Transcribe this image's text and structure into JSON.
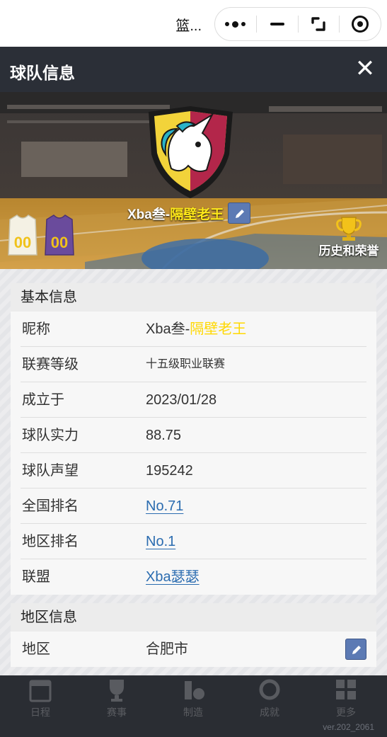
{
  "capsule": {
    "app_title": "篮...",
    "more_icon": "more-dots-icon",
    "minimize_icon": "minimize-icon",
    "switch_icon": "switch-icon",
    "close_icon": "record-circle-icon"
  },
  "dialog": {
    "title": "球队信息",
    "close_label": "✕"
  },
  "hero": {
    "team_prefix": "Xba叁-",
    "team_highlight": "隔壁老王",
    "jersey_numbers": [
      "00",
      "00"
    ],
    "honor_label": "历史和荣誉"
  },
  "basic_info": {
    "header": "基本信息",
    "rows": [
      {
        "label": "昵称",
        "value_prefix": "Xba叁-",
        "value_highlight": "隔壁老王"
      },
      {
        "label": "联赛等级",
        "value": "十五级职业联赛"
      },
      {
        "label": "成立于",
        "value": "2023/01/28"
      },
      {
        "label": "球队实力",
        "value": "88.75"
      },
      {
        "label": "球队声望",
        "value": "195242"
      },
      {
        "label": "全国排名",
        "value": "No.71"
      },
      {
        "label": "地区排名",
        "value": "No.1"
      },
      {
        "label": "联盟",
        "value": "Xba瑟瑟"
      }
    ]
  },
  "region_info": {
    "header": "地区信息",
    "rows": [
      {
        "label": "地区",
        "value": "合肥市"
      }
    ]
  },
  "tabbar": {
    "tabs": [
      "日程",
      "赛事",
      "制造",
      "成就",
      "更多"
    ],
    "version": "ver.202_2061"
  },
  "colors": {
    "header_bg": "#2b2f37",
    "highlight": "#ffe81a",
    "link": "#2b6cb0",
    "edit_button": "#5c7ab4"
  }
}
